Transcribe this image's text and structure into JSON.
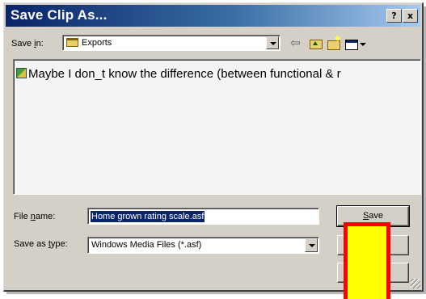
{
  "window": {
    "title": "Save Clip As...",
    "help_label": "?",
    "close_label": "x"
  },
  "toolbar": {
    "save_in_label_pre": "Save ",
    "save_in_label_u": "i",
    "save_in_label_post": "n:",
    "save_in_value": "Exports",
    "back_label": "⇦"
  },
  "file_list": {
    "items": [
      {
        "name": "Maybe I don_t know the difference (between functional & r"
      }
    ]
  },
  "form": {
    "file_name_label_pre": "File ",
    "file_name_label_u": "n",
    "file_name_label_post": "ame:",
    "file_name_value": "Home grown rating scale.asf",
    "save_type_label_pre": "Save as ",
    "save_type_label_u": "t",
    "save_type_label_post": "ype:",
    "save_type_value": "Windows Media Files (*.asf)"
  },
  "buttons": {
    "save_pre": "",
    "save_u": "S",
    "save_post": "ave",
    "cancel_label": "",
    "extra_label": ""
  },
  "colors": {
    "dialog_bg": "#d4d0c8",
    "title_gradient_start": "#0a246a",
    "highlight_fill": "#ffff00",
    "highlight_border": "#ff0000"
  }
}
